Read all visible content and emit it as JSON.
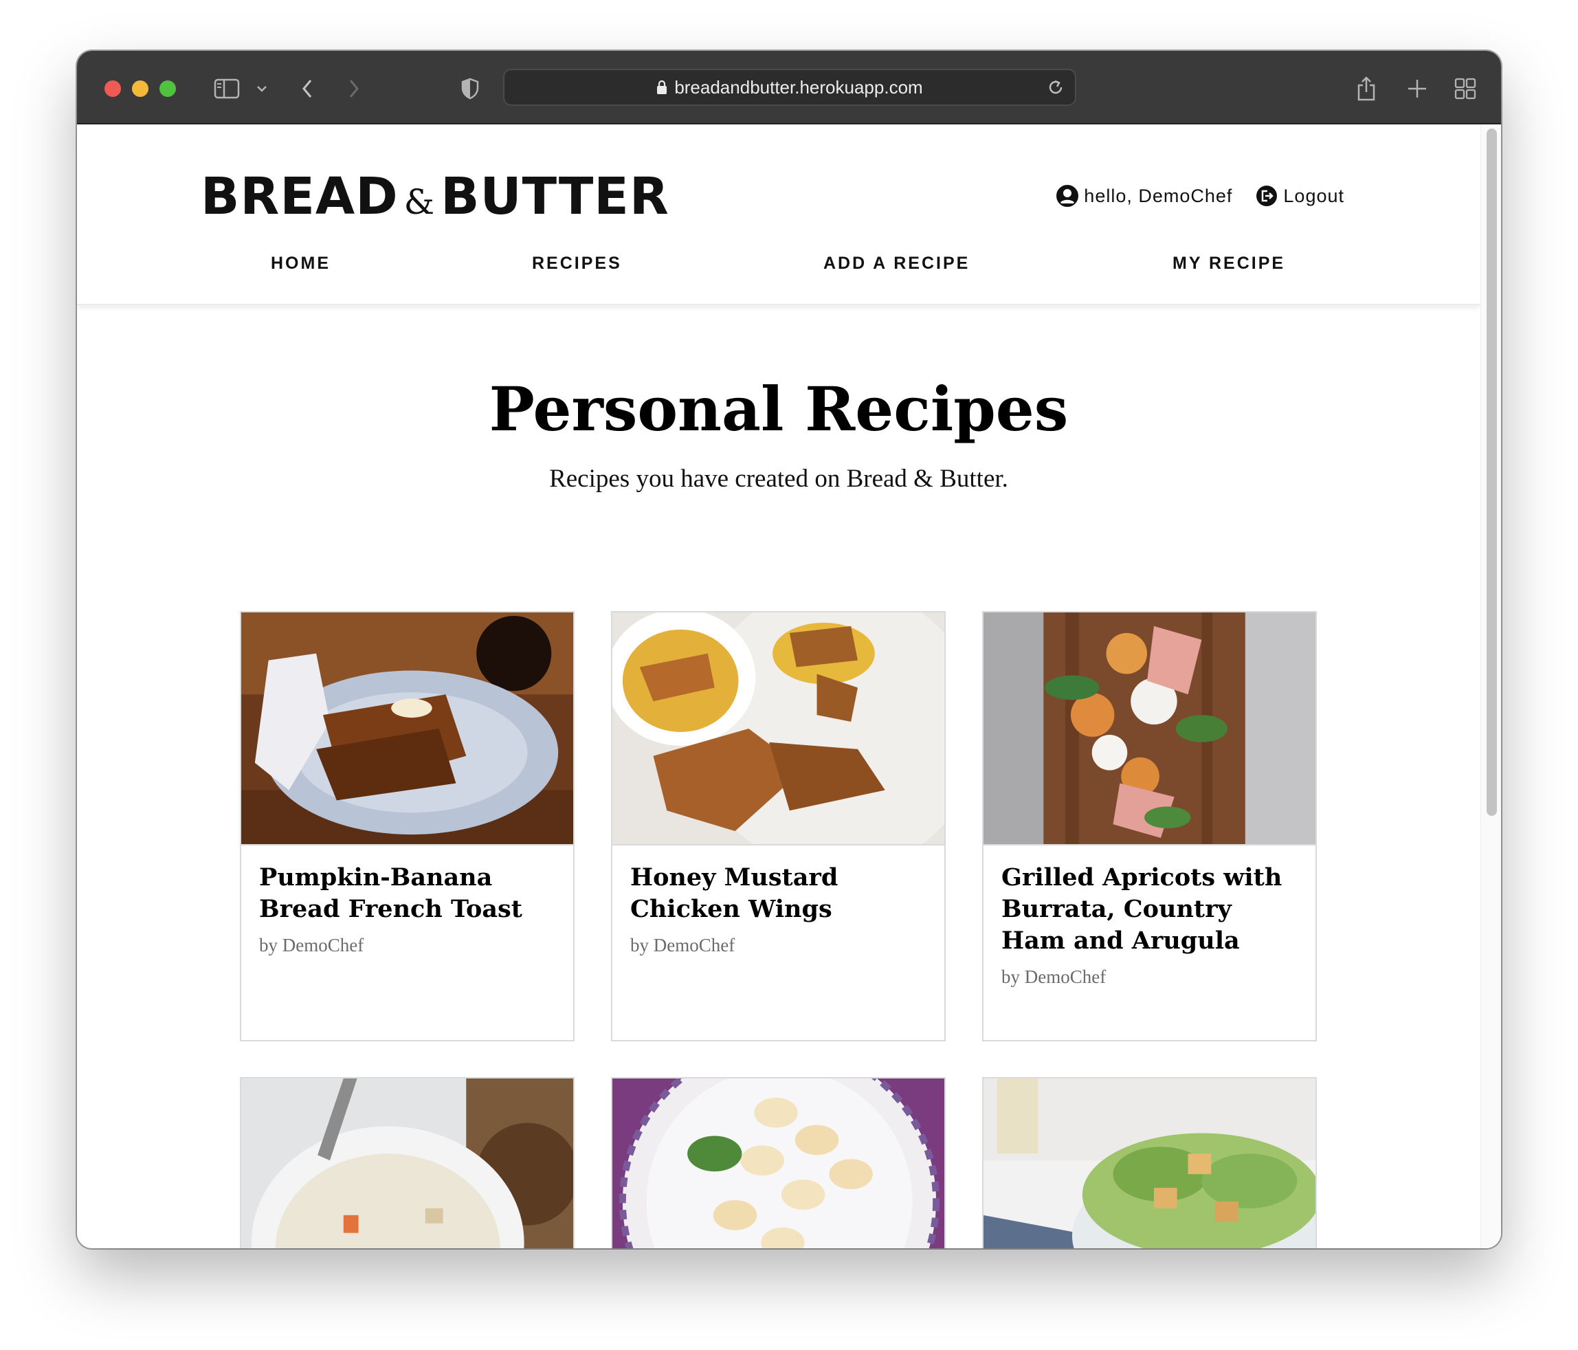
{
  "browser": {
    "url": "breadandbutter.herokuapp.com"
  },
  "header": {
    "logo_left": "BREAD",
    "logo_amp": "&",
    "logo_right": "BUTTER",
    "greeting": "hello, DemoChef",
    "logout": "Logout"
  },
  "nav": {
    "items": [
      {
        "label": "HOME"
      },
      {
        "label": "RECIPES"
      },
      {
        "label": "ADD A RECIPE"
      },
      {
        "label": "MY RECIPE"
      }
    ]
  },
  "main": {
    "title": "Personal Recipes",
    "subtitle": "Recipes you have created on Bread & Butter."
  },
  "recipes": [
    {
      "title": "Pumpkin-Banana Bread French Toast",
      "author": "by DemoChef"
    },
    {
      "title": "Honey Mustard Chicken Wings",
      "author": "by DemoChef"
    },
    {
      "title": "Grilled Apricots with Burrata, Country Ham and Arugula",
      "author": "by DemoChef"
    },
    {
      "title": "",
      "author": ""
    },
    {
      "title": "",
      "author": ""
    },
    {
      "title": "",
      "author": ""
    }
  ],
  "colors": {
    "toolbar": "#3a3a3b",
    "text": "#111111",
    "author": "#6b6b6b",
    "card_border": "#dadada"
  }
}
